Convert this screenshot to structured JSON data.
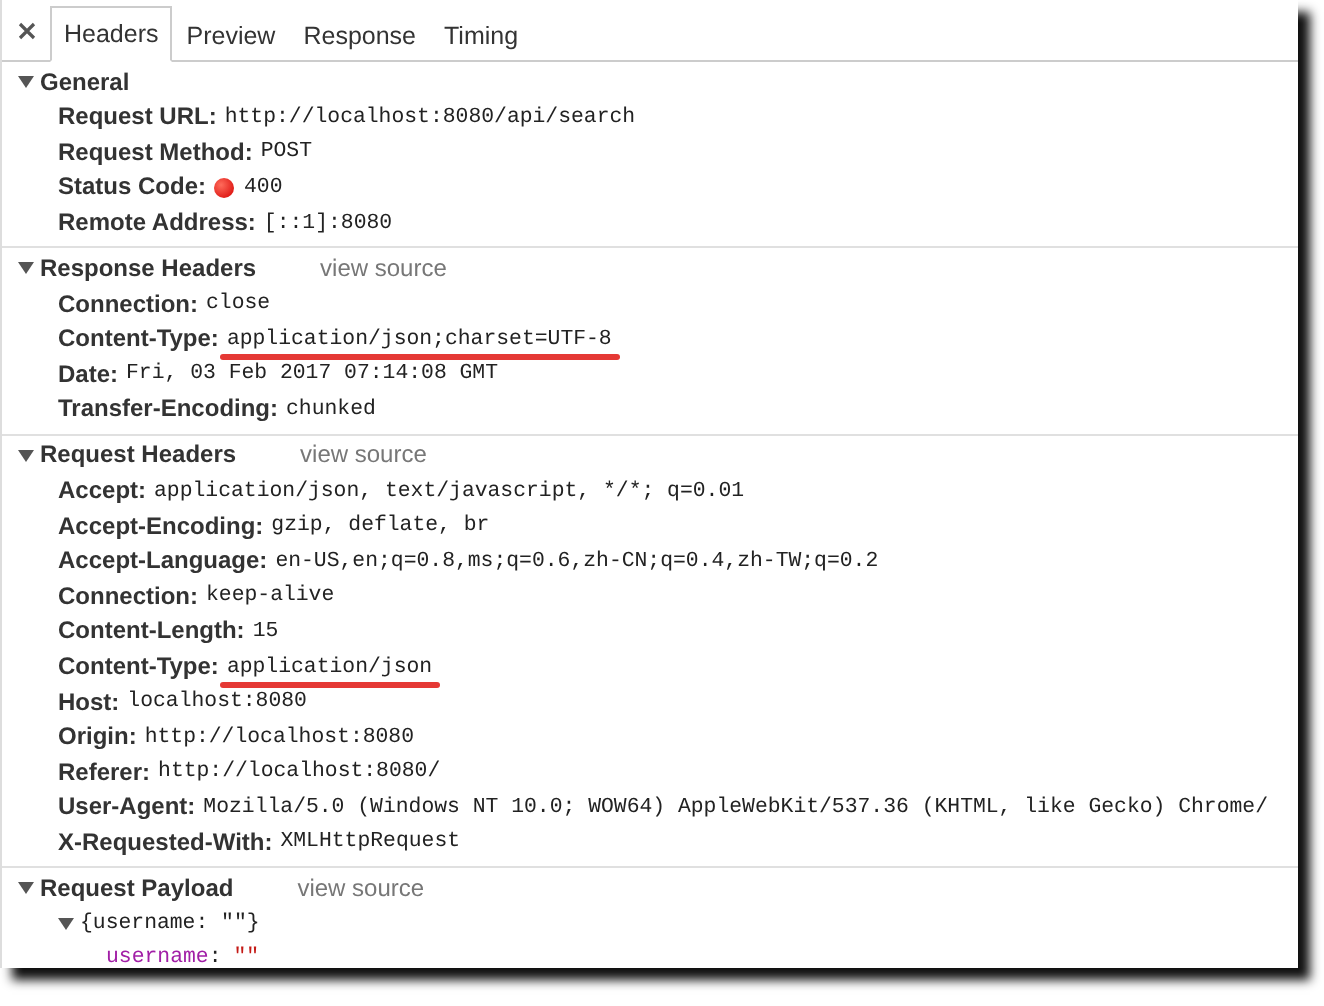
{
  "tabs": [
    {
      "label": "Headers",
      "selected": true
    },
    {
      "label": "Preview",
      "selected": false
    },
    {
      "label": "Response",
      "selected": false
    },
    {
      "label": "Timing",
      "selected": false
    }
  ],
  "sections": [
    {
      "title": "General",
      "expanded": true,
      "rows": [
        {
          "kind": "text",
          "name": "Request URL:",
          "value": "http://localhost:8080/api/search",
          "marked": false
        },
        {
          "kind": "text",
          "name": "Request Method:",
          "value": "POST",
          "marked": false
        },
        {
          "kind": "status",
          "name": "Status Code:",
          "value": "400",
          "marked": false
        },
        {
          "kind": "text",
          "name": "Remote Address:",
          "value": "[::1]:8080",
          "marked": false
        }
      ]
    },
    {
      "title": "Response Headers",
      "expanded": true,
      "link": "view source",
      "rows": [
        {
          "kind": "text",
          "name": "Connection:",
          "value": "close",
          "marked": false
        },
        {
          "kind": "text",
          "name": "Content-Type:",
          "value": "application/json;charset=UTF-8",
          "marked": true
        },
        {
          "kind": "text",
          "name": "Date:",
          "value": "Fri, 03 Feb 2017 07:14:08 GMT",
          "marked": false
        },
        {
          "kind": "text",
          "name": "Transfer-Encoding:",
          "value": "chunked",
          "marked": false
        }
      ]
    },
    {
      "title": "Request Headers",
      "expanded": true,
      "link": "view source",
      "rows": [
        {
          "kind": "text",
          "name": "Accept:",
          "value": "application/json, text/javascript, */*; q=0.01",
          "marked": false
        },
        {
          "kind": "text",
          "name": "Accept-Encoding:",
          "value": "gzip, deflate, br",
          "marked": false
        },
        {
          "kind": "text",
          "name": "Accept-Language:",
          "value": "en-US,en;q=0.8,ms;q=0.6,zh-CN;q=0.4,zh-TW;q=0.2",
          "marked": false
        },
        {
          "kind": "text",
          "name": "Connection:",
          "value": "keep-alive",
          "marked": false
        },
        {
          "kind": "text",
          "name": "Content-Length:",
          "value": "15",
          "marked": false
        },
        {
          "kind": "text",
          "name": "Content-Type:",
          "value": "application/json",
          "marked": true
        },
        {
          "kind": "text",
          "name": "Host:",
          "value": "localhost:8080",
          "marked": false
        },
        {
          "kind": "text",
          "name": "Origin:",
          "value": "http://localhost:8080",
          "marked": false
        },
        {
          "kind": "text",
          "name": "Referer:",
          "value": "http://localhost:8080/",
          "marked": false
        },
        {
          "kind": "text",
          "name": "User-Agent:",
          "value": "Mozilla/5.0 (Windows NT 10.0; WOW64) AppleWebKit/537.36 (KHTML, like Gecko) Chrome/",
          "marked": false
        },
        {
          "kind": "text",
          "name": "X-Requested-With:",
          "value": "XMLHttpRequest",
          "marked": false
        }
      ]
    }
  ],
  "payload": {
    "title": "Request Payload",
    "expanded": true,
    "link": "view source",
    "object": {
      "summary": "{username: \"\"}",
      "expanded": true,
      "properties": [
        {
          "key": "username",
          "separator": ":",
          "value": "\"\""
        }
      ]
    }
  }
}
